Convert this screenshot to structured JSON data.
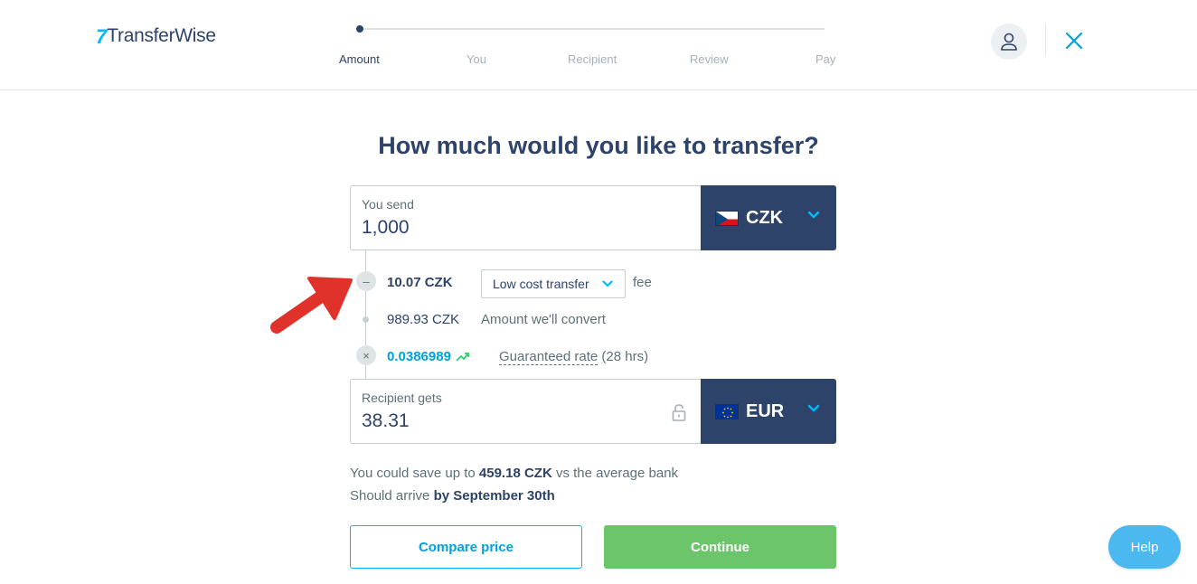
{
  "header": {
    "logo_mark": "7",
    "logo_text": "TransferWise",
    "steps": [
      "Amount",
      "You",
      "Recipient",
      "Review",
      "Pay"
    ],
    "active_step": "Amount"
  },
  "title": "How much would you like to transfer?",
  "send": {
    "label": "You send",
    "value": "1,000",
    "currency": "CZK"
  },
  "breakdown": {
    "fee_amount": "10.07 CZK",
    "fee_option": "Low cost transfer",
    "fee_suffix": "fee",
    "convert_amount": "989.93 CZK",
    "convert_label": "Amount we'll convert",
    "rate": "0.0386989",
    "rate_label": "Guaranteed rate",
    "rate_duration": "(28 hrs)"
  },
  "receive": {
    "label": "Recipient gets",
    "value": "38.31",
    "currency": "EUR"
  },
  "savings": {
    "prefix": "You could save up to",
    "amount": "459.18 CZK",
    "suffix": "vs the average bank",
    "arrive_prefix": "Should arrive",
    "arrive_date": "by September 30th"
  },
  "buttons": {
    "compare": "Compare price",
    "continue": "Continue",
    "help": "Help"
  },
  "colors": {
    "navy": "#2e4369",
    "accent_blue": "#00b9ff",
    "green": "#6cc56b",
    "annotation_red": "#e0322b"
  }
}
